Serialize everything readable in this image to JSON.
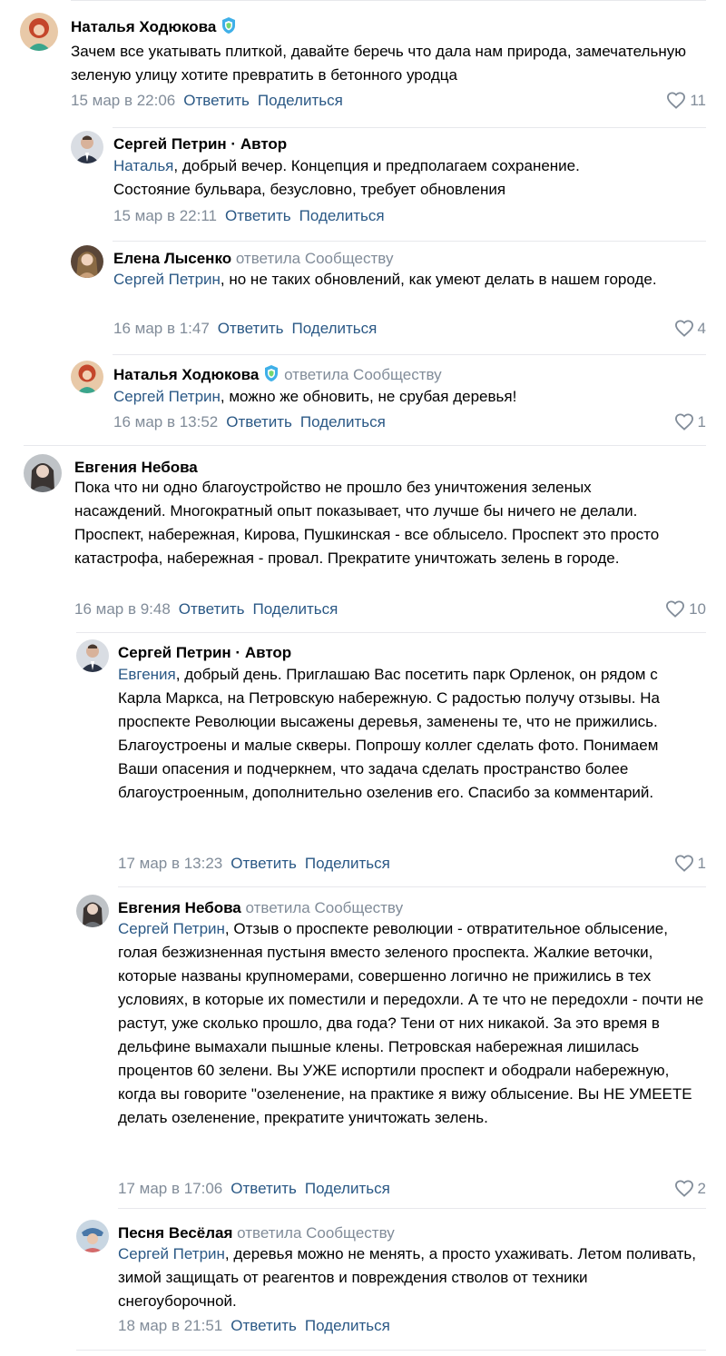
{
  "actions": {
    "reply": "Ответить",
    "share": "Поделиться"
  },
  "author_separator": " · ",
  "author_label": "Автор",
  "comments": [
    {
      "name": "Наталья Ходюкова",
      "verified": true,
      "text": "Зачем все укатывать плиткой, давайте беречь что дала нам природа, замечательную зеленую улицу хотите превратить в бетонного уродца",
      "date": "15 мар в 22:06",
      "likes": "11"
    },
    {
      "name": "Сергей Петрин",
      "is_author": true,
      "mention": "Наталья",
      "text": ", добрый вечер. Концепция и предполагаем сохранение. Состояние бульвара, безусловно, требует обновления",
      "date": "15 мар в 22:11"
    },
    {
      "name": "Елена Лысенко",
      "replied": "ответила Сообществу",
      "mention": "Сергей Петрин",
      "text": ", но не таких обновлений, как умеют делать в нашем городе.",
      "date": "16 мар в 1:47",
      "likes": "4"
    },
    {
      "name": "Наталья Ходюкова",
      "verified": true,
      "replied": "ответила Сообществу",
      "mention": "Сергей Петрин",
      "text": ", можно же обновить, не срубая деревья!",
      "date": "16 мар в 13:52",
      "likes": "1"
    },
    {
      "name": "Евгения Небова",
      "text": "Пока что ни одно благоустройство не прошло без уничтожения зеленых насаждений. Многократный опыт показывает, что лучше бы ничего не делали. Проспект, набережная, Кирова, Пушкинская - все облысело. Проспект это просто катастрофа, набережная - провал. Прекратите уничтожать зелень в городе.",
      "date": "16 мар в 9:48",
      "likes": "10"
    },
    {
      "name": "Сергей Петрин",
      "is_author": true,
      "mention": "Евгения",
      "text": ", добрый день. Приглашаю Вас посетить парк Орленок, он рядом с Карла Маркса, на Петровскую набережную. С радостью получу отзывы. На проспекте Революции высажены деревья, заменены те, что не прижились. Благоустроены и малые скверы. Попрошу коллег сделать фото. Понимаем Ваши опасения и подчеркнем, что задача сделать пространство более благоустроенным, дополнительно озеленив его. Спасибо за комментарий.",
      "date": "17 мар в 13:23",
      "likes": "1"
    },
    {
      "name": "Евгения Небова",
      "replied": "ответила Сообществу",
      "mention": "Сергей Петрин",
      "text": ", Отзыв о проспекте революции - отвратительное облысение, голая безжизненная пустыня вместо зеленого проспекта. Жалкие веточки, которые названы крупномерами, совершенно логично не прижились в тех условиях, в которые их поместили и передохли. А те что не передохли - почти не растут, уже сколько прошло, два года? Тени от них никакой. За это время в дельфине вымахали пышные клены. Петровская набережная лишилась процентов 60 зелени. Вы УЖЕ испортили проспект и ободрали набережную, когда вы говорите \"озеленение, на практике я вижу облысение. Вы НЕ УМЕЕТЕ делать озеленение, прекратите уничтожать зелень.",
      "date": "17 мар в 17:06",
      "likes": "2"
    },
    {
      "name": "Песня Весёлая",
      "replied": "ответила Сообществу",
      "mention": "Сергей Петрин",
      "text": ", деревья можно не менять, а просто ухаживать. Летом поливать, зимой защищать от реагентов и повреждения стволов от техники снегоуборочной.",
      "date": "18 мар в 21:51"
    }
  ],
  "colors": {
    "link": "#2a5885",
    "secondary": "#818c99",
    "separator": "#e7e8ec",
    "verified": "#3fb0e8"
  }
}
